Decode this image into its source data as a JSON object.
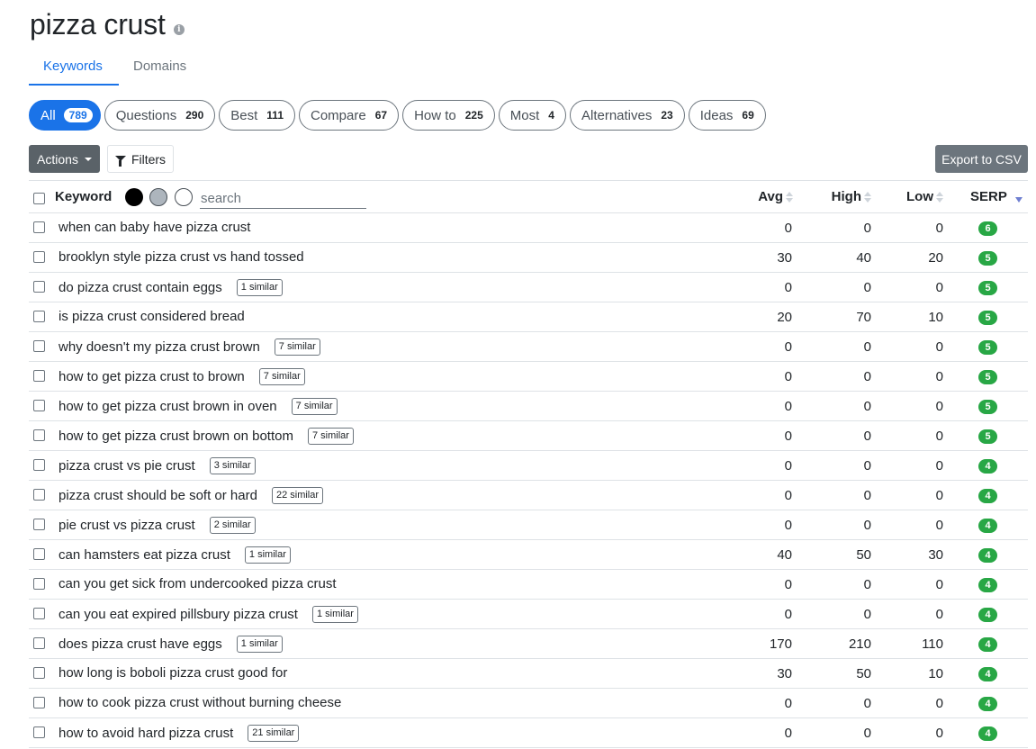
{
  "page": {
    "title": "pizza crust",
    "info_icon": "info-icon"
  },
  "tabs": [
    {
      "label": "Keywords",
      "active": true
    },
    {
      "label": "Domains",
      "active": false
    }
  ],
  "filters": [
    {
      "label": "All",
      "count": "789",
      "active": true
    },
    {
      "label": "Questions",
      "count": "290"
    },
    {
      "label": "Best",
      "count": "111"
    },
    {
      "label": "Compare",
      "count": "67"
    },
    {
      "label": "How to",
      "count": "225"
    },
    {
      "label": "Most",
      "count": "4"
    },
    {
      "label": "Alternatives",
      "count": "23"
    },
    {
      "label": "Ideas",
      "count": "69"
    }
  ],
  "toolbar": {
    "actions_label": "Actions",
    "filters_label": "Filters",
    "export_label": "Export to CSV"
  },
  "table": {
    "header": {
      "keyword": "Keyword",
      "avg": "Avg",
      "high": "High",
      "low": "Low",
      "serp": "SERP",
      "search_placeholder": "search"
    },
    "rows": [
      {
        "keyword": "when can baby have pizza crust",
        "similar": "",
        "avg": "0",
        "high": "0",
        "low": "0",
        "serp": "6"
      },
      {
        "keyword": "brooklyn style pizza crust vs hand tossed",
        "similar": "",
        "avg": "30",
        "high": "40",
        "low": "20",
        "serp": "5"
      },
      {
        "keyword": "do pizza crust contain eggs",
        "similar": "1 similar",
        "avg": "0",
        "high": "0",
        "low": "0",
        "serp": "5"
      },
      {
        "keyword": "is pizza crust considered bread",
        "similar": "",
        "avg": "20",
        "high": "70",
        "low": "10",
        "serp": "5"
      },
      {
        "keyword": "why doesn't my pizza crust brown",
        "similar": "7 similar",
        "avg": "0",
        "high": "0",
        "low": "0",
        "serp": "5"
      },
      {
        "keyword": "how to get pizza crust to brown",
        "similar": "7 similar",
        "avg": "0",
        "high": "0",
        "low": "0",
        "serp": "5"
      },
      {
        "keyword": "how to get pizza crust brown in oven",
        "similar": "7 similar",
        "avg": "0",
        "high": "0",
        "low": "0",
        "serp": "5"
      },
      {
        "keyword": "how to get pizza crust brown on bottom",
        "similar": "7 similar",
        "avg": "0",
        "high": "0",
        "low": "0",
        "serp": "5"
      },
      {
        "keyword": "pizza crust vs pie crust",
        "similar": "3 similar",
        "avg": "0",
        "high": "0",
        "low": "0",
        "serp": "4"
      },
      {
        "keyword": "pizza crust should be soft or hard",
        "similar": "22 similar",
        "avg": "0",
        "high": "0",
        "low": "0",
        "serp": "4"
      },
      {
        "keyword": "pie crust vs pizza crust",
        "similar": "2 similar",
        "avg": "0",
        "high": "0",
        "low": "0",
        "serp": "4"
      },
      {
        "keyword": "can hamsters eat pizza crust",
        "similar": "1 similar",
        "avg": "40",
        "high": "50",
        "low": "30",
        "serp": "4"
      },
      {
        "keyword": "can you get sick from undercooked pizza crust",
        "similar": "",
        "avg": "0",
        "high": "0",
        "low": "0",
        "serp": "4"
      },
      {
        "keyword": "can you eat expired pillsbury pizza crust",
        "similar": "1 similar",
        "avg": "0",
        "high": "0",
        "low": "0",
        "serp": "4"
      },
      {
        "keyword": "does pizza crust have eggs",
        "similar": "1 similar",
        "avg": "170",
        "high": "210",
        "low": "110",
        "serp": "4"
      },
      {
        "keyword": "how long is boboli pizza crust good for",
        "similar": "",
        "avg": "30",
        "high": "50",
        "low": "10",
        "serp": "4"
      },
      {
        "keyword": "how to cook pizza crust without burning cheese",
        "similar": "",
        "avg": "0",
        "high": "0",
        "low": "0",
        "serp": "4"
      },
      {
        "keyword": "how to avoid hard pizza crust",
        "similar": "21 similar",
        "avg": "0",
        "high": "0",
        "low": "0",
        "serp": "4"
      }
    ]
  },
  "colors": {
    "accent": "#1a73e8",
    "serp_badge": "#28a745",
    "actions_bg": "#5a6268",
    "export_bg": "#6c757d"
  }
}
